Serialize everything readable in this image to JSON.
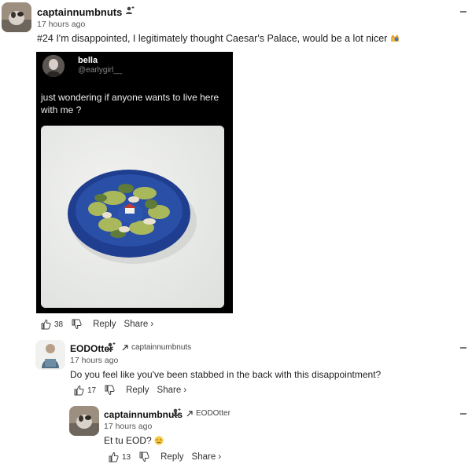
{
  "comment1": {
    "username": "captainnumbnuts",
    "time": "17 hours ago",
    "text": "#24 I'm disappointed, I legitimately thought Caesar's Palace, would be a lot nicer",
    "likes": "38",
    "reply_label": "Reply",
    "share_label": "Share ›",
    "embed": {
      "name": "bella",
      "handle": "@earlygirl__",
      "text": "just wondering if anyone wants to live here with me ?"
    }
  },
  "comment2": {
    "username": "EODOtter",
    "reply_to": "captainnumbnuts",
    "time": "17 hours ago",
    "text": "Do you feel like you've been stabbed in the back with this disappointment?",
    "likes": "17",
    "reply_label": "Reply",
    "share_label": "Share ›"
  },
  "comment3": {
    "username": "captainnumbnuts",
    "reply_to": "EODOtter",
    "time": "17 hours ago",
    "text": "Et tu EOD?",
    "likes": "13",
    "reply_label": "Reply",
    "share_label": "Share ›"
  }
}
